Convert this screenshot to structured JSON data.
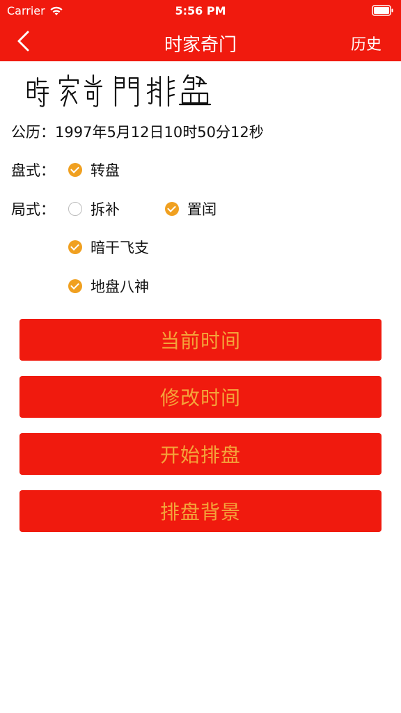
{
  "status_bar": {
    "carrier": "Carrier",
    "time": "5:56 PM"
  },
  "nav": {
    "title": "时家奇门",
    "history": "历史"
  },
  "header": {
    "calligraphy_text": "時家奇門排盤"
  },
  "calendar": {
    "label": "公历：",
    "value": "1997年5月12日10时50分12秒"
  },
  "pan_style": {
    "label": "盘式：",
    "options": [
      {
        "label": "转盘",
        "checked": true
      }
    ]
  },
  "ju_style": {
    "label": "局式：",
    "options": [
      {
        "label": "拆补",
        "checked": false
      },
      {
        "label": "置闰",
        "checked": true
      },
      {
        "label": "暗干飞支",
        "checked": true
      },
      {
        "label": "地盘八神",
        "checked": true
      }
    ]
  },
  "buttons": {
    "current_time": "当前时间",
    "modify_time": "修改时间",
    "start": "开始排盘",
    "background": "排盘背景"
  },
  "colors": {
    "primary_red": "#f01a0e",
    "button_text": "#f4a43a",
    "check_on": "#f0a020"
  }
}
